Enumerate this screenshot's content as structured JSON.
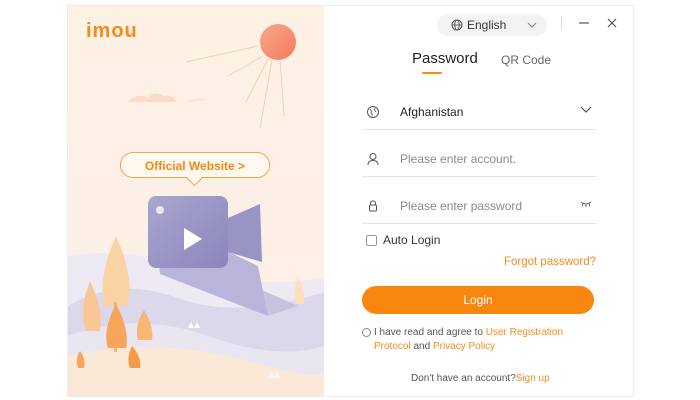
{
  "brand": {
    "logo_text": "imou"
  },
  "promo": {
    "official_website": "Official Website >"
  },
  "window": {
    "language": "English",
    "minimize_glyph": "—",
    "close_glyph": "✕"
  },
  "tabs": {
    "password": "Password",
    "qr_code": "QR Code",
    "active": "password"
  },
  "form": {
    "country": "Afghanistan",
    "account_placeholder": "Please enter account.",
    "password_placeholder": "Please enter password",
    "auto_login": "Auto Login",
    "auto_login_checked": false,
    "forgot_password": "Forgot password?",
    "login": "Login"
  },
  "agreement": {
    "prefix": "I have read and agree to ",
    "user_registration": "User Registration",
    "protocol": "Protocol",
    "and": " and ",
    "privacy_policy": "Privacy Policy",
    "checked": false
  },
  "signup": {
    "prompt": "Don't have an account?",
    "link": "Sign up"
  },
  "colors": {
    "accent": "#f7870f",
    "link": "#f28c1b",
    "placeholder": "#8a8a8a"
  },
  "icons": [
    "globe-icon",
    "chevron-down-icon",
    "minimize-icon",
    "close-icon",
    "region-icon",
    "user-icon",
    "lock-icon",
    "eye-closed-icon",
    "video-camera-icon",
    "sun-icon"
  ]
}
